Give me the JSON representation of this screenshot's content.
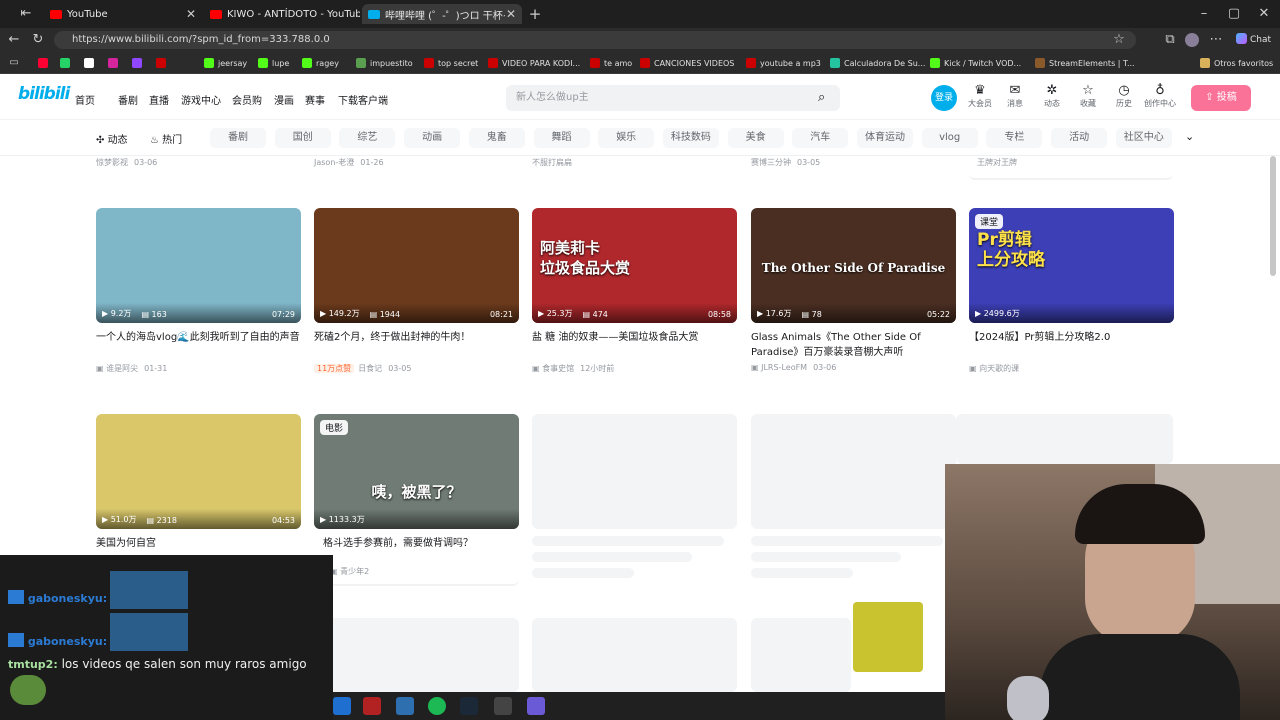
{
  "browser": {
    "tabs": [
      {
        "title": "YouTube",
        "color": "#ff0000"
      },
      {
        "title": "KIWO - ANTÍDOTO - YouTube",
        "color": "#ff0000"
      },
      {
        "title": "哔哩哔哩 (゜-゜)つロ 干杯~-bilibili",
        "color": "#00aeec"
      }
    ],
    "new_tab": "+",
    "url": "https://www.bilibili.com/?spm_id_from=333.788.0.0",
    "bookmarks": [
      "",
      "",
      "",
      "",
      "",
      "",
      "jeersay",
      "lupe",
      "ragey",
      "impuestito",
      "top secret",
      "VIDEO PARA KODI...",
      "te amo",
      "CANCIONES VIDEOS",
      "youtube a mp3",
      "Calculadora De Su...",
      "Kick / Twitch VOD...",
      "StreamElements | T..."
    ],
    "other_bookmarks": "Otros favoritos",
    "chat_label": "Chat"
  },
  "header": {
    "logo": "bilibili",
    "nav": [
      "首页",
      "番剧",
      "直播",
      "游戏中心",
      "会员购",
      "漫画",
      "赛事",
      "下载客户端"
    ],
    "search_placeholder": "新人怎么做up主",
    "login": "登录",
    "icons": [
      "大会员",
      "消息",
      "动态",
      "收藏",
      "历史",
      "创作中心"
    ],
    "upload": "投稿"
  },
  "categories": {
    "links": [
      "动态",
      "热门"
    ],
    "tabs": [
      "番剧",
      "国创",
      "综艺",
      "动画",
      "鬼畜",
      "舞蹈",
      "娱乐",
      "科技数码",
      "美食",
      "汽车",
      "体育运动",
      "vlog",
      "专栏",
      "活动",
      "社区中心"
    ]
  },
  "top_row_meta": [
    {
      "author": "惊梦影视",
      "date": "03-06"
    },
    {
      "author": "Jason-老澄",
      "date": "01-26"
    },
    {
      "author": "不服打扁扁",
      "date": ""
    },
    {
      "author": "赛博三分钟",
      "date": "03-05"
    },
    {
      "author": "王牌对王牌",
      "date": ""
    }
  ],
  "videos": [
    {
      "views": "9.2万",
      "danmaku": "163",
      "duration": "07:29",
      "title": "一个人的海岛vlog🌊此刻我听到了自由的声音",
      "author": "谁是阿尖",
      "date": "01-31",
      "thumb": "#7fb6c8"
    },
    {
      "views": "149.2万",
      "danmaku": "1944",
      "duration": "08:21",
      "title": "死磕2个月，终于做出封神的牛肉！",
      "badge": "11万点赞",
      "author": "日食记",
      "date": "03-05",
      "thumb": "#6b3a1c"
    },
    {
      "views": "25.3万",
      "danmaku": "474",
      "duration": "08:58",
      "title": "盐 糖 油的奴隶——美国垃圾食品大赏",
      "author": "食事史馆",
      "date": "12小时前",
      "thumb": "#b0282c",
      "overlay": "阿美莉卡\n垃圾食品大赏"
    },
    {
      "views": "17.6万",
      "danmaku": "78",
      "duration": "05:22",
      "title": "Glass Animals《The Other Side Of Paradise》百万豪装录音棚大声听",
      "author": "JLRS-LeoFM",
      "date": "03-06",
      "thumb": "#4a2e22",
      "overlay": "The Other Side Of Paradise"
    },
    {
      "views": "2499.6万",
      "danmaku": "",
      "duration": "",
      "title": "【2024版】Pr剪辑上分攻略2.0",
      "author": "向天歌的课",
      "date": "",
      "thumb": "#3c3fb5",
      "tag": "课堂",
      "overlay": "Pr剪辑\n上分攻略"
    },
    {
      "views": "51.0万",
      "danmaku": "2318",
      "duration": "04:53",
      "title": "美国为何自宫",
      "author": "",
      "date": "",
      "thumb": "#d9c76a"
    },
    {
      "views": "1133.3万",
      "danmaku": "",
      "duration": "",
      "title": "格斗选手参赛前，需要做背调吗？",
      "author": "青少年2",
      "date": "",
      "thumb": "#6f7b74",
      "tag": "电影",
      "overlay": "咦，被黑了？"
    }
  ],
  "chat": [
    {
      "user": "gaboneskyu:",
      "text": ""
    },
    {
      "user": "gaboneskyu:",
      "text": ""
    },
    {
      "user": "tmtup2:",
      "text": "los videos qe salen son muy raros amigo"
    }
  ],
  "colors": {
    "bili_blue": "#00aeec",
    "bili_pink": "#fb7299"
  }
}
